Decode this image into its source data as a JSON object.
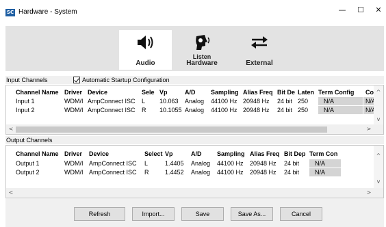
{
  "window": {
    "app_icon_text": "SC",
    "title": "Hardware - System",
    "minimize_glyph": "—",
    "maximize_glyph": "☐",
    "close_glyph": "✕"
  },
  "toolbar": {
    "audio_label": "Audio",
    "listen_label": "Listen",
    "hardware_label": "Hardware",
    "external_label": "External"
  },
  "input_channels": {
    "section_label": "Input Channels",
    "auto_startup_label": "Automatic Startup Configuration",
    "auto_startup_checked": true,
    "columns": [
      "Channel Name",
      "Driver",
      "Device",
      "Sele",
      "Vp",
      "A/D",
      "Sampling",
      "Alias Freq",
      "Bit De",
      "Laten",
      "Term Config",
      "Cou"
    ],
    "rows": [
      [
        "Input 1",
        "WDM/I",
        "AmpConnect ISC",
        "L",
        "10.063",
        "Analog",
        "44100 Hz",
        "20948 Hz",
        "24 bit",
        "250",
        "N/A",
        "N/A"
      ],
      [
        "Input 2",
        "WDM/I",
        "AmpConnect ISC",
        "R",
        "10.1055",
        "Analog",
        "44100 Hz",
        "20948 Hz",
        "24 bit",
        "250",
        "N/A",
        "N/A"
      ]
    ]
  },
  "output_channels": {
    "section_label": "Output Channels",
    "columns": [
      "Channel Name",
      "Driver",
      "Device",
      "Select",
      "Vp",
      "A/D",
      "Sampling",
      "Alias Freq",
      "Bit Dep",
      "Term Con"
    ],
    "rows": [
      [
        "Output 1",
        "WDM/I",
        "AmpConnect ISC",
        "L",
        "1.4405",
        "Analog",
        "44100 Hz",
        "20948 Hz",
        "24 bit",
        "N/A"
      ],
      [
        "Output 2",
        "WDM/I",
        "AmpConnect ISC",
        "R",
        "1.4452",
        "Analog",
        "44100 Hz",
        "20948 Hz",
        "24 bit",
        "N/A"
      ]
    ]
  },
  "footer": {
    "refresh_label": "Refresh",
    "import_label": "Import...",
    "save_label": "Save",
    "save_as_label": "Save As...",
    "cancel_label": "Cancel"
  },
  "colors": {
    "toolbar_bg": "#e3e3e3",
    "grey_cell": "#d4d4d4",
    "app_icon": "#1f5fa3"
  },
  "icons": [
    "speaker-icon",
    "listen-hardware-icon",
    "arrows-exchange-icon",
    "checkbox-checked-icon",
    "chevron-icons"
  ]
}
